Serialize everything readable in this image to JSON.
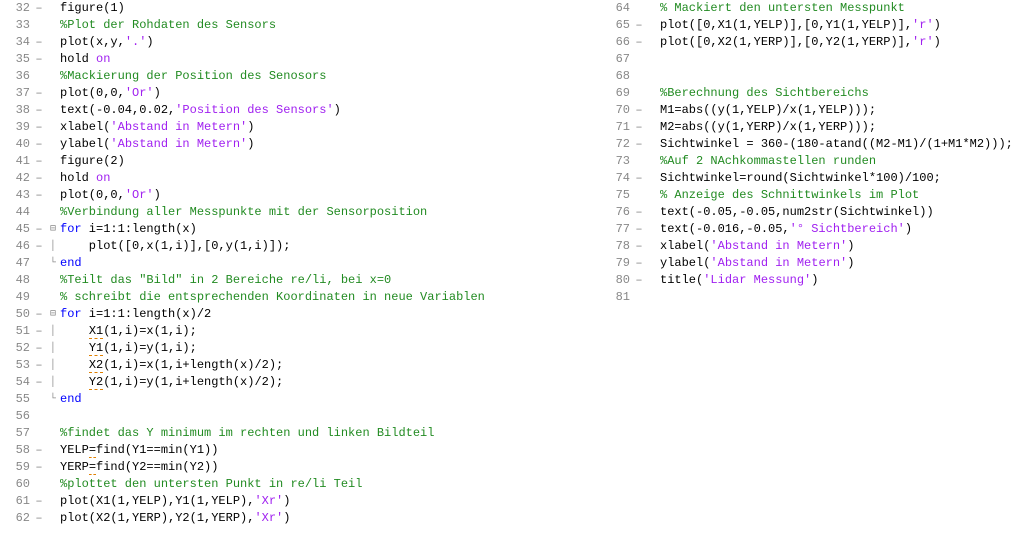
{
  "left": [
    {
      "n": 32,
      "m": "–",
      "f": "",
      "tokens": [
        [
          "tx",
          "figure(1)"
        ]
      ]
    },
    {
      "n": 33,
      "m": "",
      "f": "",
      "tokens": [
        [
          "cm",
          "%Plot der Rohdaten des Sensors"
        ]
      ]
    },
    {
      "n": 34,
      "m": "–",
      "f": "",
      "tokens": [
        [
          "tx",
          "plot(x,y,"
        ],
        [
          "st",
          "'.'"
        ],
        [
          "tx",
          ")"
        ]
      ]
    },
    {
      "n": 35,
      "m": "–",
      "f": "",
      "tokens": [
        [
          "tx",
          "hold "
        ],
        [
          "st",
          "on"
        ]
      ]
    },
    {
      "n": 36,
      "m": "",
      "f": "",
      "tokens": [
        [
          "cm",
          "%Mackierung der Position des Senosors"
        ]
      ]
    },
    {
      "n": 37,
      "m": "–",
      "f": "",
      "tokens": [
        [
          "tx",
          "plot(0,0,"
        ],
        [
          "st",
          "'Or'"
        ],
        [
          "tx",
          ")"
        ]
      ]
    },
    {
      "n": 38,
      "m": "–",
      "f": "",
      "tokens": [
        [
          "tx",
          "text(-0.04,0.02,"
        ],
        [
          "st",
          "'Position des Sensors'"
        ],
        [
          "tx",
          ")"
        ]
      ]
    },
    {
      "n": 39,
      "m": "–",
      "f": "",
      "tokens": [
        [
          "tx",
          "xlabel("
        ],
        [
          "st",
          "'Abstand in Metern'"
        ],
        [
          "tx",
          ")"
        ]
      ]
    },
    {
      "n": 40,
      "m": "–",
      "f": "",
      "tokens": [
        [
          "tx",
          "ylabel("
        ],
        [
          "st",
          "'Abstand in Metern'"
        ],
        [
          "tx",
          ")"
        ]
      ]
    },
    {
      "n": 41,
      "m": "–",
      "f": "",
      "tokens": [
        [
          "tx",
          "figure(2)"
        ]
      ]
    },
    {
      "n": 42,
      "m": "–",
      "f": "",
      "tokens": [
        [
          "tx",
          "hold "
        ],
        [
          "st",
          "on"
        ]
      ]
    },
    {
      "n": 43,
      "m": "–",
      "f": "",
      "tokens": [
        [
          "tx",
          "plot(0,0,"
        ],
        [
          "st",
          "'Or'"
        ],
        [
          "tx",
          ")"
        ]
      ]
    },
    {
      "n": 44,
      "m": "",
      "f": "",
      "tokens": [
        [
          "cm",
          "%Verbindung aller Messpunkte mit der Sensorposition"
        ]
      ]
    },
    {
      "n": 45,
      "m": "–",
      "f": "⊟",
      "tokens": [
        [
          "kw",
          "for"
        ],
        [
          "tx",
          " i=1:1:length(x)"
        ]
      ]
    },
    {
      "n": 46,
      "m": "–",
      "f": "│",
      "tokens": [
        [
          "tx",
          "    plot([0,x(1,i)],[0,y(1,i)]);"
        ]
      ]
    },
    {
      "n": 47,
      "m": "",
      "f": "└",
      "tokens": [
        [
          "kw",
          "end"
        ]
      ]
    },
    {
      "n": 48,
      "m": "",
      "f": "",
      "tokens": [
        [
          "cm",
          "%Teilt das \"Bild\" in 2 Bereiche re/li, bei x=0"
        ]
      ]
    },
    {
      "n": 49,
      "m": "",
      "f": "",
      "tokens": [
        [
          "cm",
          "% schreibt die entsprechenden Koordinaten in neue Variablen"
        ]
      ]
    },
    {
      "n": 50,
      "m": "–",
      "f": "⊟",
      "tokens": [
        [
          "kw",
          "for"
        ],
        [
          "tx",
          " i=1:1:length(x)/2"
        ]
      ]
    },
    {
      "n": 51,
      "m": "–",
      "f": "│",
      "tokens": [
        [
          "tx",
          "    "
        ],
        [
          "warn",
          "X1"
        ],
        [
          "tx",
          "(1,i)=x(1,i);"
        ]
      ]
    },
    {
      "n": 52,
      "m": "–",
      "f": "│",
      "tokens": [
        [
          "tx",
          "    "
        ],
        [
          "warn",
          "Y1"
        ],
        [
          "tx",
          "(1,i)=y(1,i);"
        ]
      ]
    },
    {
      "n": 53,
      "m": "–",
      "f": "│",
      "tokens": [
        [
          "tx",
          "    "
        ],
        [
          "warn",
          "X2"
        ],
        [
          "tx",
          "(1,i)=x(1,i+length(x)/2);"
        ]
      ]
    },
    {
      "n": 54,
      "m": "–",
      "f": "│",
      "tokens": [
        [
          "tx",
          "    "
        ],
        [
          "warn",
          "Y2"
        ],
        [
          "tx",
          "(1,i)=y(1,i+length(x)/2);"
        ]
      ]
    },
    {
      "n": 55,
      "m": "",
      "f": "└",
      "tokens": [
        [
          "kw",
          "end"
        ]
      ]
    },
    {
      "n": 56,
      "m": "",
      "f": "",
      "tokens": []
    },
    {
      "n": 57,
      "m": "",
      "f": "",
      "tokens": [
        [
          "cm",
          "%findet das Y minimum im rechten und linken Bildteil"
        ]
      ]
    },
    {
      "n": 58,
      "m": "–",
      "f": "",
      "tokens": [
        [
          "tx",
          "YELP"
        ],
        [
          "warn",
          "="
        ],
        [
          "tx",
          "find(Y1==min(Y1))"
        ]
      ]
    },
    {
      "n": 59,
      "m": "–",
      "f": "",
      "tokens": [
        [
          "tx",
          "YERP"
        ],
        [
          "warn",
          "="
        ],
        [
          "tx",
          "find(Y2==min(Y2))"
        ]
      ]
    },
    {
      "n": 60,
      "m": "",
      "f": "",
      "tokens": [
        [
          "cm",
          "%plottet den untersten Punkt in re/li Teil"
        ]
      ]
    },
    {
      "n": 61,
      "m": "–",
      "f": "",
      "tokens": [
        [
          "tx",
          "plot(X1(1,YELP),Y1(1,YELP),"
        ],
        [
          "st",
          "'Xr'"
        ],
        [
          "tx",
          ")"
        ]
      ]
    },
    {
      "n": 62,
      "m": "–",
      "f": "",
      "tokens": [
        [
          "tx",
          "plot(X2(1,YERP),Y2(1,YERP),"
        ],
        [
          "st",
          "'Xr'"
        ],
        [
          "tx",
          ")"
        ]
      ]
    }
  ],
  "right": [
    {
      "n": 64,
      "m": "",
      "f": "",
      "tokens": [
        [
          "cm",
          "% Mackiert den untersten Messpunkt"
        ]
      ]
    },
    {
      "n": 65,
      "m": "–",
      "f": "",
      "tokens": [
        [
          "tx",
          "plot([0,X1(1,YELP)],[0,Y1(1,YELP)],"
        ],
        [
          "st",
          "'r'"
        ],
        [
          "tx",
          ")"
        ]
      ]
    },
    {
      "n": 66,
      "m": "–",
      "f": "",
      "tokens": [
        [
          "tx",
          "plot([0,X2(1,YERP)],[0,Y2(1,YERP)],"
        ],
        [
          "st",
          "'r'"
        ],
        [
          "tx",
          ")"
        ]
      ]
    },
    {
      "n": 67,
      "m": "",
      "f": "",
      "tokens": []
    },
    {
      "n": 68,
      "m": "",
      "f": "",
      "tokens": []
    },
    {
      "n": 69,
      "m": "",
      "f": "",
      "tokens": [
        [
          "cm",
          "%Berechnung des Sichtbereichs"
        ]
      ]
    },
    {
      "n": 70,
      "m": "–",
      "f": "",
      "tokens": [
        [
          "tx",
          "M1=abs((y(1,YELP)/x(1,YELP)));"
        ]
      ]
    },
    {
      "n": 71,
      "m": "–",
      "f": "",
      "tokens": [
        [
          "tx",
          "M2=abs((y(1,YERP)/x(1,YERP)));"
        ]
      ]
    },
    {
      "n": 72,
      "m": "–",
      "f": "",
      "tokens": [
        [
          "tx",
          "Sichtwinkel = 360-(180-atand((M2-M1)/(1+M1*M2)));"
        ]
      ]
    },
    {
      "n": 73,
      "m": "",
      "f": "",
      "tokens": [
        [
          "cm",
          "%Auf 2 NAchkommastellen runden"
        ]
      ]
    },
    {
      "n": 74,
      "m": "–",
      "f": "",
      "tokens": [
        [
          "tx",
          "Sichtwinkel=round(Sichtwinkel*100)/100;"
        ]
      ]
    },
    {
      "n": 75,
      "m": "",
      "f": "",
      "tokens": [
        [
          "cm",
          "% Anzeige des Schnittwinkels im Plot"
        ]
      ]
    },
    {
      "n": 76,
      "m": "–",
      "f": "",
      "tokens": [
        [
          "tx",
          "text(-0.05,-0.05,num2str(Sichtwinkel))"
        ]
      ]
    },
    {
      "n": 77,
      "m": "–",
      "f": "",
      "tokens": [
        [
          "tx",
          "text(-0.016,-0.05,"
        ],
        [
          "st",
          "'° Sichtbereich'"
        ],
        [
          "tx",
          ")"
        ]
      ]
    },
    {
      "n": 78,
      "m": "–",
      "f": "",
      "tokens": [
        [
          "tx",
          "xlabel("
        ],
        [
          "st",
          "'Abstand in Metern'"
        ],
        [
          "tx",
          ")"
        ]
      ]
    },
    {
      "n": 79,
      "m": "–",
      "f": "",
      "tokens": [
        [
          "tx",
          "ylabel("
        ],
        [
          "st",
          "'Abstand in Metern'"
        ],
        [
          "tx",
          ")"
        ]
      ]
    },
    {
      "n": 80,
      "m": "–",
      "f": "",
      "tokens": [
        [
          "tx",
          "title("
        ],
        [
          "st",
          "'Lidar Messung'"
        ],
        [
          "tx",
          ")"
        ]
      ]
    },
    {
      "n": 81,
      "m": "",
      "f": "",
      "tokens": []
    }
  ]
}
